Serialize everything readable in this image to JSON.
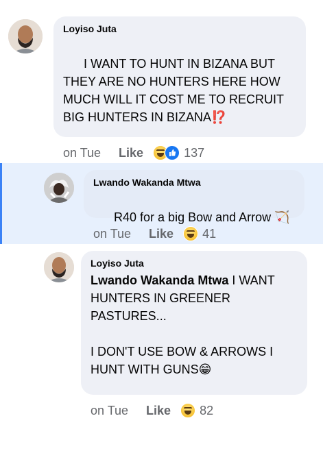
{
  "comments": [
    {
      "author": "Loyiso Juta",
      "mention": "",
      "text": "I WANT TO HUNT IN BIZANA BUT THEY ARE NO HUNTERS HERE HOW MUCH WILL IT COST ME TO RECRUIT BIG HUNTERS IN BIZANA",
      "trailing": "⁉️",
      "time": "on Tue",
      "like_label": "Like",
      "reactions": [
        "haha",
        "like"
      ],
      "reaction_count": "137"
    },
    {
      "author": "Lwando Wakanda Mtwa",
      "mention": "",
      "text": "R40 for a big Bow and Arrow",
      "trailing": "🏹",
      "time": "on Tue",
      "like_label": "Like",
      "reactions": [
        "haha"
      ],
      "reaction_count": "41"
    },
    {
      "author": "Loyiso Juta",
      "mention": "Lwando Wakanda Mtwa",
      "text": " I WANT HUNTERS IN GREENER PASTURES...\n\nI DON'T USE BOW & ARROWS I HUNT WITH GUNS",
      "trailing": "😁",
      "time": "on Tue",
      "like_label": "Like",
      "reactions": [
        "haha"
      ],
      "reaction_count": "82"
    }
  ],
  "colors": {
    "bubble": "#eef0f6",
    "reply_highlight": "#e7f0fd",
    "meta_text": "#65676b",
    "like_blue": "#1877f2"
  }
}
